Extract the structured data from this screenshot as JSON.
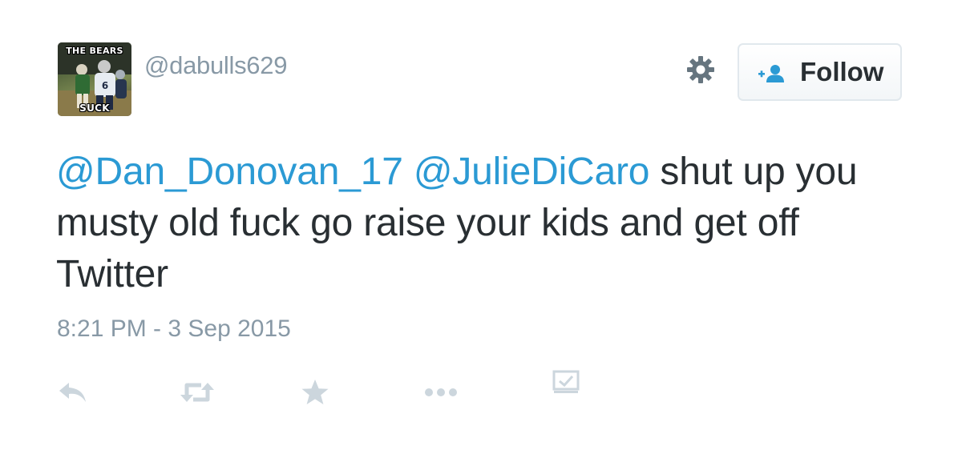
{
  "user": {
    "handle": "@dabulls629",
    "avatar": {
      "caption_top": "THE BEARS",
      "caption_bottom": "SUCK",
      "jersey_number": "6"
    }
  },
  "header": {
    "settings_icon": "gear-icon",
    "follow": {
      "label": "Follow",
      "icon": "follow-user-icon"
    }
  },
  "tweet": {
    "mention_1": "@Dan_Donovan_17",
    "mention_2": "@JulieDiCaro",
    "text": " shut up you musty old fuck go raise your kids and get off Twitter",
    "timestamp": "8:21 PM - 3 Sep 2015"
  },
  "actions": [
    {
      "name": "reply",
      "icon": "reply-icon"
    },
    {
      "name": "retweet",
      "icon": "retweet-icon"
    },
    {
      "name": "favorite",
      "icon": "star-icon"
    },
    {
      "name": "more",
      "icon": "more-dots-icon"
    },
    {
      "name": "analytics",
      "icon": "analytics-icon"
    }
  ],
  "colors": {
    "mention": "#2b9ad4",
    "text": "#292f33",
    "muted": "#8899a6",
    "icon": "#ccd6dd",
    "follow_icon": "#2b9ad4"
  }
}
